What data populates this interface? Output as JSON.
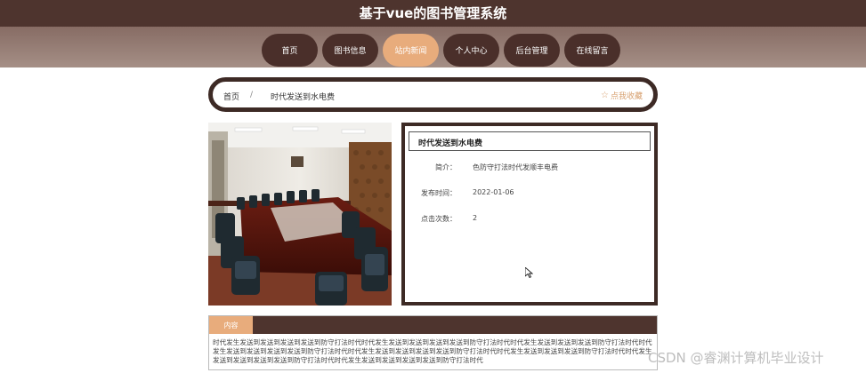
{
  "header": {
    "title": "基于vue的图书管理系统"
  },
  "nav": {
    "tabs": [
      {
        "label": "首页",
        "active": false
      },
      {
        "label": "图书信息",
        "active": false
      },
      {
        "label": "站内新闻",
        "active": true
      },
      {
        "label": "个人中心",
        "active": false
      },
      {
        "label": "后台管理",
        "active": false
      },
      {
        "label": "在线留言",
        "active": false
      }
    ]
  },
  "breadcrumb": {
    "home": "首页",
    "separator": "/",
    "current": "时代发送到水电费",
    "favorite_label": "点我收藏"
  },
  "detail": {
    "name": "时代发送到水电费",
    "fields": [
      {
        "label": "简介：",
        "value": "色防守打法时代发顺丰电费"
      },
      {
        "label": "发布时间：",
        "value": "2022-01-06"
      },
      {
        "label": "点击次数：",
        "value": "2"
      }
    ]
  },
  "content": {
    "tab_label": "内容",
    "text": "时代发生发送到发送到发送到发送到防守打法时代时代发生发送到发送到发送到发送到防守打法时代时代发生发送到发送到发送到防守打法时代时代发生发送到发送到发送到发送到防守打法时代时代发生发送到发送到发送到发送到防守打法时代时代发生发送到发送到发送到防守打法时代时代发生发送到发送到发送到发送到防守打法时代时代发生发送到发送到发送到发送到防守打法时代"
  },
  "watermark": "CSDN @睿渊计算机毕业设计",
  "colors": {
    "dark_brown": "#4e342e",
    "accent": "#e8ac7c",
    "nav_tab": "#4a2f2a"
  }
}
